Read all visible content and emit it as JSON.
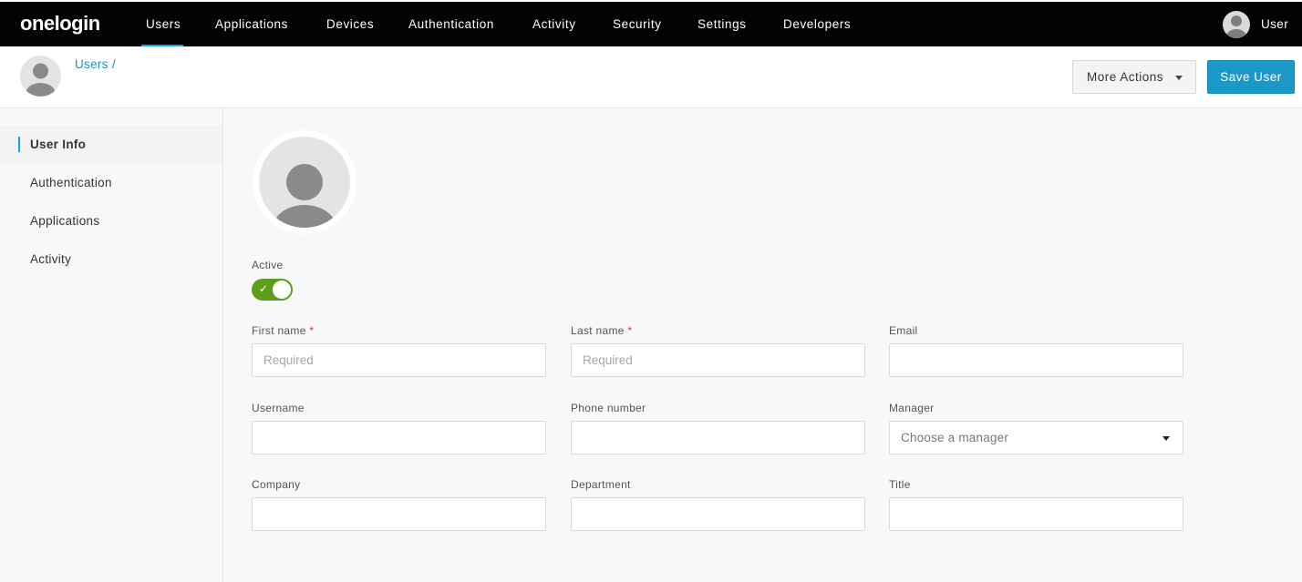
{
  "app": {
    "logo": "onelogin"
  },
  "nav": {
    "items": [
      "Users",
      "Applications",
      "Devices",
      "Authentication",
      "Activity",
      "Security",
      "Settings",
      "Developers"
    ],
    "active": "Users",
    "user_label": "User"
  },
  "header": {
    "breadcrumb": "Users",
    "breadcrumb_sep": "/",
    "more_actions_label": "More Actions",
    "save_label": "Save User"
  },
  "sidebar": {
    "items": [
      "User Info",
      "Authentication",
      "Applications",
      "Activity"
    ],
    "active": "User Info"
  },
  "form": {
    "active_label": "Active",
    "active_on": true,
    "first_name": {
      "label": "First name",
      "required": "*",
      "value": "",
      "placeholder": "Required"
    },
    "last_name": {
      "label": "Last name",
      "required": "*",
      "value": "",
      "placeholder": "Required"
    },
    "email": {
      "label": "Email",
      "value": "",
      "placeholder": ""
    },
    "username": {
      "label": "Username",
      "value": "",
      "placeholder": ""
    },
    "phone": {
      "label": "Phone number",
      "value": "",
      "placeholder": ""
    },
    "manager": {
      "label": "Manager",
      "placeholder": "Choose a manager"
    },
    "company": {
      "label": "Company",
      "value": "",
      "placeholder": ""
    },
    "department": {
      "label": "Department",
      "value": "",
      "placeholder": ""
    },
    "title": {
      "label": "Title",
      "value": "",
      "placeholder": ""
    }
  },
  "colors": {
    "nav_bg": "#030303",
    "accent": "#1aa3cf",
    "primary_button": "#1a98c8",
    "toggle_on": "#5a9e1a",
    "required": "#d9363e"
  },
  "icons": {
    "nav_avatar": "user-avatar-icon",
    "header_avatar": "user-avatar-icon",
    "profile": "user-avatar-icon",
    "dropdown": "caret-down-icon",
    "toggle_check": "check-icon"
  }
}
